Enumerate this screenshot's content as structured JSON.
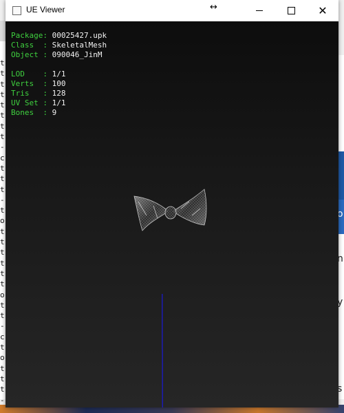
{
  "window": {
    "title": "UE Viewer",
    "minimize_icon": "minimize-icon",
    "maximize_icon": "maximize-icon",
    "close_icon": "close-icon"
  },
  "info": {
    "package_label": "Package:",
    "package_value": "00025427.upk",
    "class_label": "Class  :",
    "class_value": "SkeletalMesh",
    "object_label": "Object :",
    "object_value": "090046_JinM",
    "lod_label": "LOD    :",
    "lod_value": "1/1",
    "verts_label": "Verts  :",
    "verts_value": "100",
    "tris_label": "Tris   :",
    "tris_value": "128",
    "uvset_label": "UV Set :",
    "uvset_value": "1/1",
    "bones_label": "Bones  :",
    "bones_value": "9"
  },
  "background": {
    "left_letters": [
      "t",
      "t",
      "t",
      "t",
      "t",
      "t",
      "t",
      "t",
      "-",
      "c",
      "t",
      "t",
      "t",
      "-",
      "t",
      "o",
      "t",
      "t",
      "t",
      "t",
      "t",
      "t",
      "o",
      "t",
      "t",
      "-",
      "c",
      "t",
      "o",
      "t",
      "t",
      "t",
      "-",
      "c",
      "t"
    ],
    "right_glyphs": [
      "o",
      "n",
      "y",
      "s"
    ]
  },
  "colors": {
    "label": "#3fd13f",
    "value": "#f2f2f2",
    "axis": "#1a1ad8",
    "viewport_top": "#0d0d0d",
    "viewport_bottom": "#262626"
  }
}
